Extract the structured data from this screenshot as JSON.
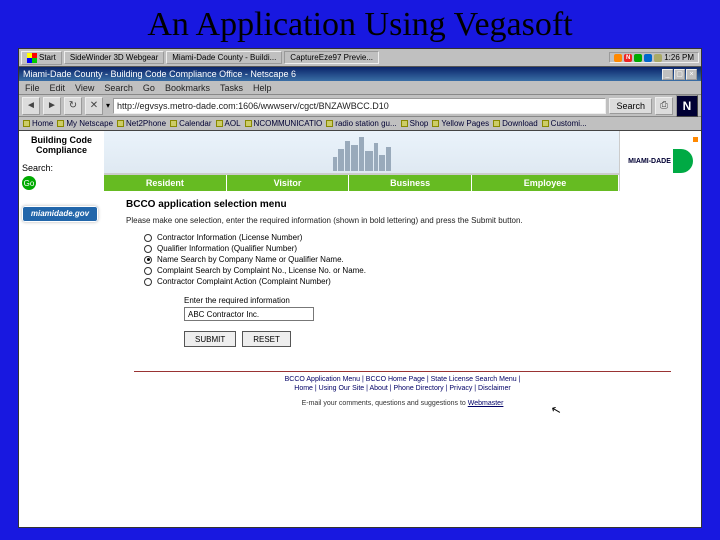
{
  "slide": {
    "title": "An Application Using Vegasoft"
  },
  "taskbar": {
    "start": "Start",
    "buttons": [
      "SideWinder 3D Webgear",
      "Miami-Dade County - Buildi...",
      "CaptureEze97 Previe..."
    ],
    "time": "1:26 PM"
  },
  "browser": {
    "title": "Miami-Dade County - Building Code Compliance Office - Netscape 6",
    "menu": [
      "File",
      "Edit",
      "View",
      "Search",
      "Go",
      "Bookmarks",
      "Tasks",
      "Help"
    ],
    "url": "http://egvsys.metro-dade.com:1606/wwwserv/cgct/BNZAWBCC.D10",
    "search_label": "Search",
    "bookmarks": [
      "Home",
      "My Netscape",
      "Net2Phone",
      "Calendar",
      "AOL",
      "NCOMMUNICATIO",
      "radio station gu...",
      "Shop",
      "Yellow Pages",
      "Download",
      "Customi..."
    ]
  },
  "sidebar": {
    "heading": "Building Code Compliance",
    "search_label": "Search:",
    "banner": "miamidade.gov"
  },
  "tabs": [
    "Resident",
    "Visitor",
    "Business",
    "Employee"
  ],
  "brand": "MIAMI-DADE",
  "page": {
    "section_title": "BCCO application selection menu",
    "instruction": "Please make one selection, enter the required information (shown in bold lettering) and press the Submit button.",
    "options": [
      {
        "label": "Contractor Information (License Number)",
        "selected": false
      },
      {
        "label": "Qualifier Information (Qualifier Number)",
        "selected": false
      },
      {
        "label": "Name Search by Company Name or Qualifier Name.",
        "selected": true
      },
      {
        "label": "Complaint Search by Complaint No., License No. or Name.",
        "selected": false
      },
      {
        "label": "Contractor Complaint Action (Complaint Number)",
        "selected": false
      }
    ],
    "input_label": "Enter the required information",
    "input_value": "ABC Contractor Inc.",
    "submit": "SUBMIT",
    "reset": "RESET"
  },
  "footer": {
    "row1": "BCCO Application Menu | BCCO Home Page | State License Search Menu |",
    "row2": "Home | Using Our Site | About | Phone Directory | Privacy | Disclaimer",
    "email_prefix": "E-mail your comments, questions and suggestions to ",
    "email_link": "Webmaster"
  }
}
